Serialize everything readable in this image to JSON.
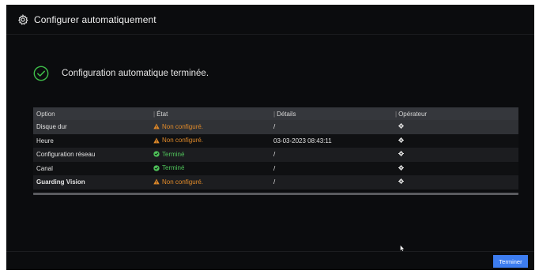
{
  "window": {
    "title": "Configurer automatiquement",
    "icon": "settings-gear-icon"
  },
  "status": {
    "message": "Configuration automatique terminée.",
    "icon": "success-check-icon",
    "color": "#3fbf4a"
  },
  "table": {
    "headers": {
      "option": "Option",
      "etat": "État",
      "details": "Détails",
      "operateur": "Opérateur"
    },
    "rows": [
      {
        "option": "Disque dur",
        "etat": "Non configuré.",
        "state": "warning",
        "details": "/",
        "operator_icon": "gear-icon"
      },
      {
        "option": "Heure",
        "etat": "Non configuré.",
        "state": "warning",
        "details": "03-03-2023 08:43:11",
        "operator_icon": "gear-icon"
      },
      {
        "option": "Configuration réseau",
        "etat": "Terminé",
        "state": "done",
        "details": "/",
        "operator_icon": "gear-icon"
      },
      {
        "option": "Canal",
        "etat": "Terminé",
        "state": "done",
        "details": "/",
        "operator_icon": "gear-icon"
      },
      {
        "option": "Guarding Vision",
        "etat": "Non configuré.",
        "state": "warning",
        "details": "/",
        "operator_icon": "gear-icon"
      }
    ]
  },
  "colors": {
    "warning": "#e08a2a",
    "done": "#4fc35a",
    "accent": "#3d7df0",
    "background": "#0b0c0e"
  },
  "footer": {
    "finish_label": "Terminer"
  }
}
